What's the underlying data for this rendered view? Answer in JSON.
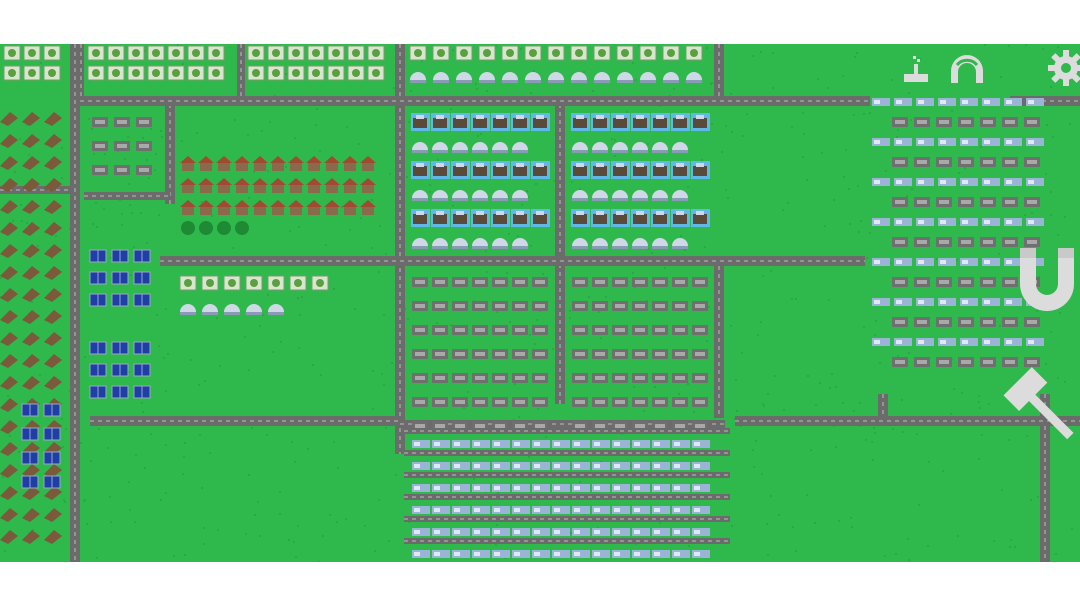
{
  "game": {
    "title": "",
    "view": "factory-map",
    "colors": {
      "grass": "#2fb84c",
      "grass_dark": "#29a845",
      "road": "#6b6b6b",
      "road_line": "#bdbdbd",
      "hud_icon": "#dcdcdc",
      "conveyor": "#9ab4d6",
      "machine": "#5a4a3a",
      "panel": "#1f3fa6",
      "highlight": "#5fb8e8"
    }
  },
  "hud": {
    "buttons": [
      {
        "name": "build-factory-button",
        "icon": "factory-icon"
      },
      {
        "name": "build-wall-button",
        "icon": "arch-icon"
      },
      {
        "name": "settings-button",
        "icon": "gear-icon"
      },
      {
        "name": "magnet-tool-button",
        "icon": "magnet-icon"
      },
      {
        "name": "hammer-tool-button",
        "icon": "hammer-icon"
      }
    ]
  },
  "map": {
    "sectors": [
      {
        "name": "sector-top-left-farms",
        "contents": "greenhouses"
      },
      {
        "name": "sector-top-right-domes",
        "contents": "storage-domes"
      },
      {
        "name": "sector-left-sawmills",
        "contents": "sawmills"
      },
      {
        "name": "sector-solar-panels",
        "contents": "solar-panels"
      },
      {
        "name": "sector-village",
        "contents": "houses"
      },
      {
        "name": "sector-blue-production-left",
        "contents": "workshops"
      },
      {
        "name": "sector-blue-production-right",
        "contents": "workshops"
      },
      {
        "name": "sector-mining-left",
        "contents": "ore-processing"
      },
      {
        "name": "sector-mining-right",
        "contents": "ore-processing"
      },
      {
        "name": "sector-conveyor-grid",
        "contents": "conveyors"
      },
      {
        "name": "sector-right-factory",
        "contents": "assemblers"
      }
    ]
  }
}
